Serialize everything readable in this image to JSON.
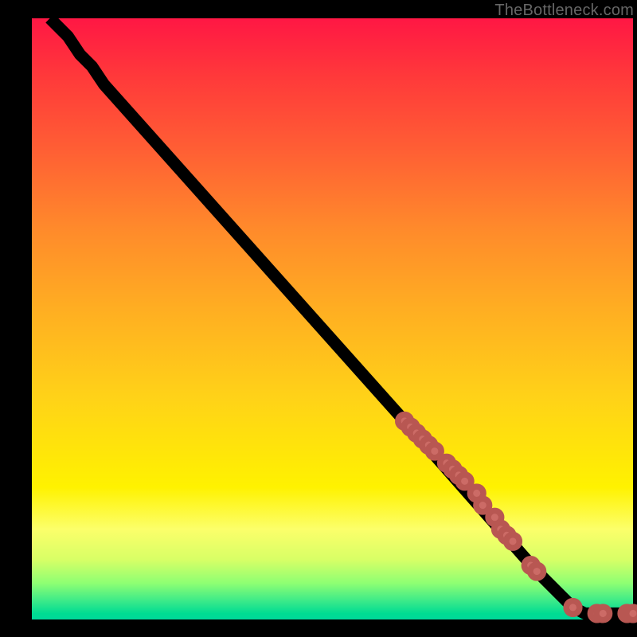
{
  "watermark": "TheBottleneck.com",
  "chart_data": {
    "type": "line",
    "title": "",
    "xlabel": "",
    "ylabel": "",
    "xlim": [
      0,
      100
    ],
    "ylim": [
      0,
      100
    ],
    "grid": false,
    "legend": false,
    "line_color": "#000000",
    "marker_color": "#cc6b66",
    "curve_points": [
      {
        "x": 3,
        "y": 100
      },
      {
        "x": 6,
        "y": 97
      },
      {
        "x": 8,
        "y": 94
      },
      {
        "x": 10,
        "y": 92
      },
      {
        "x": 12,
        "y": 89
      },
      {
        "x": 62,
        "y": 33
      },
      {
        "x": 84,
        "y": 8
      },
      {
        "x": 88,
        "y": 4
      },
      {
        "x": 90,
        "y": 2
      },
      {
        "x": 92,
        "y": 1
      },
      {
        "x": 94,
        "y": 1
      },
      {
        "x": 96,
        "y": 1
      },
      {
        "x": 98,
        "y": 1
      },
      {
        "x": 100,
        "y": 1
      }
    ],
    "markers": [
      {
        "x": 62,
        "y": 33
      },
      {
        "x": 63,
        "y": 32
      },
      {
        "x": 64,
        "y": 31
      },
      {
        "x": 65,
        "y": 30
      },
      {
        "x": 66,
        "y": 29
      },
      {
        "x": 67,
        "y": 28
      },
      {
        "x": 69,
        "y": 26
      },
      {
        "x": 70,
        "y": 25
      },
      {
        "x": 71,
        "y": 24
      },
      {
        "x": 72,
        "y": 23
      },
      {
        "x": 74,
        "y": 21
      },
      {
        "x": 75,
        "y": 19
      },
      {
        "x": 77,
        "y": 17
      },
      {
        "x": 78,
        "y": 15
      },
      {
        "x": 79,
        "y": 14
      },
      {
        "x": 80,
        "y": 13
      },
      {
        "x": 83,
        "y": 9
      },
      {
        "x": 84,
        "y": 8
      },
      {
        "x": 90,
        "y": 2
      },
      {
        "x": 94,
        "y": 1
      },
      {
        "x": 95,
        "y": 1
      },
      {
        "x": 99,
        "y": 1
      },
      {
        "x": 100,
        "y": 1
      }
    ]
  }
}
